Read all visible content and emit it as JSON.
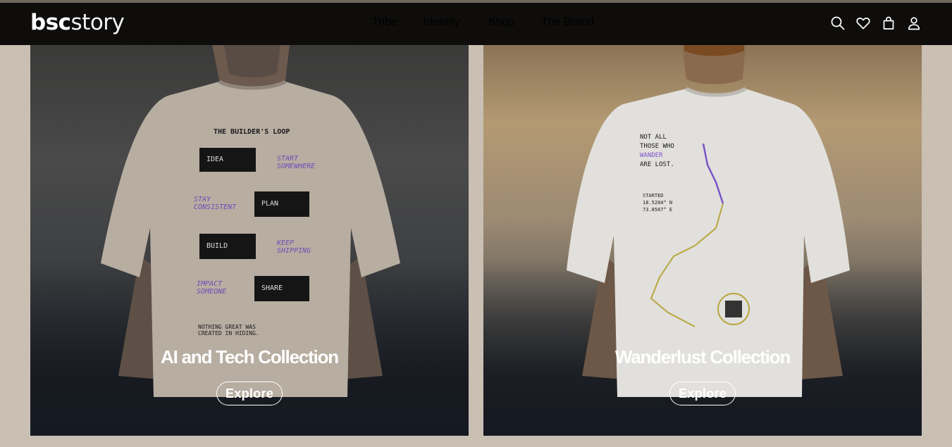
{
  "header": {
    "logo_part1": "bsc",
    "logo_part2": "story",
    "nav": [
      "Tribe",
      "Identity",
      "Shop",
      "The Brand"
    ],
    "icons": [
      "search-icon",
      "heart-icon",
      "bag-icon",
      "user-icon"
    ]
  },
  "cards": [
    {
      "title": "AI and Tech Collection",
      "button": "Explore",
      "print": {
        "heading": "THE BUILDER'S LOOP",
        "steps": [
          "IDEA",
          "PLAN",
          "BUILD",
          "SHARE"
        ],
        "notes": [
          "START SOMEWHERE",
          "STAY CONSISTENT",
          "KEEP SHIPPING",
          "IMPACT SOMEONE"
        ],
        "footer": "NOTHING GREAT WAS CREATED IN HIDING."
      }
    },
    {
      "title": "Wanderlust Collection",
      "button": "Explore",
      "print": {
        "quote_1": "NOT ALL",
        "quote_2": "THOSE WHO",
        "quote_3": "WANDER",
        "quote_4": "ARE LOST.",
        "started": "STARTED",
        "coord_1": "18.5204° N",
        "coord_2": "73.8567° E"
      }
    }
  ],
  "colors": {
    "header_bg": "#0e0d0c",
    "page_bg": "#c9bfb3",
    "accent_purple": "#6a4fb8"
  }
}
